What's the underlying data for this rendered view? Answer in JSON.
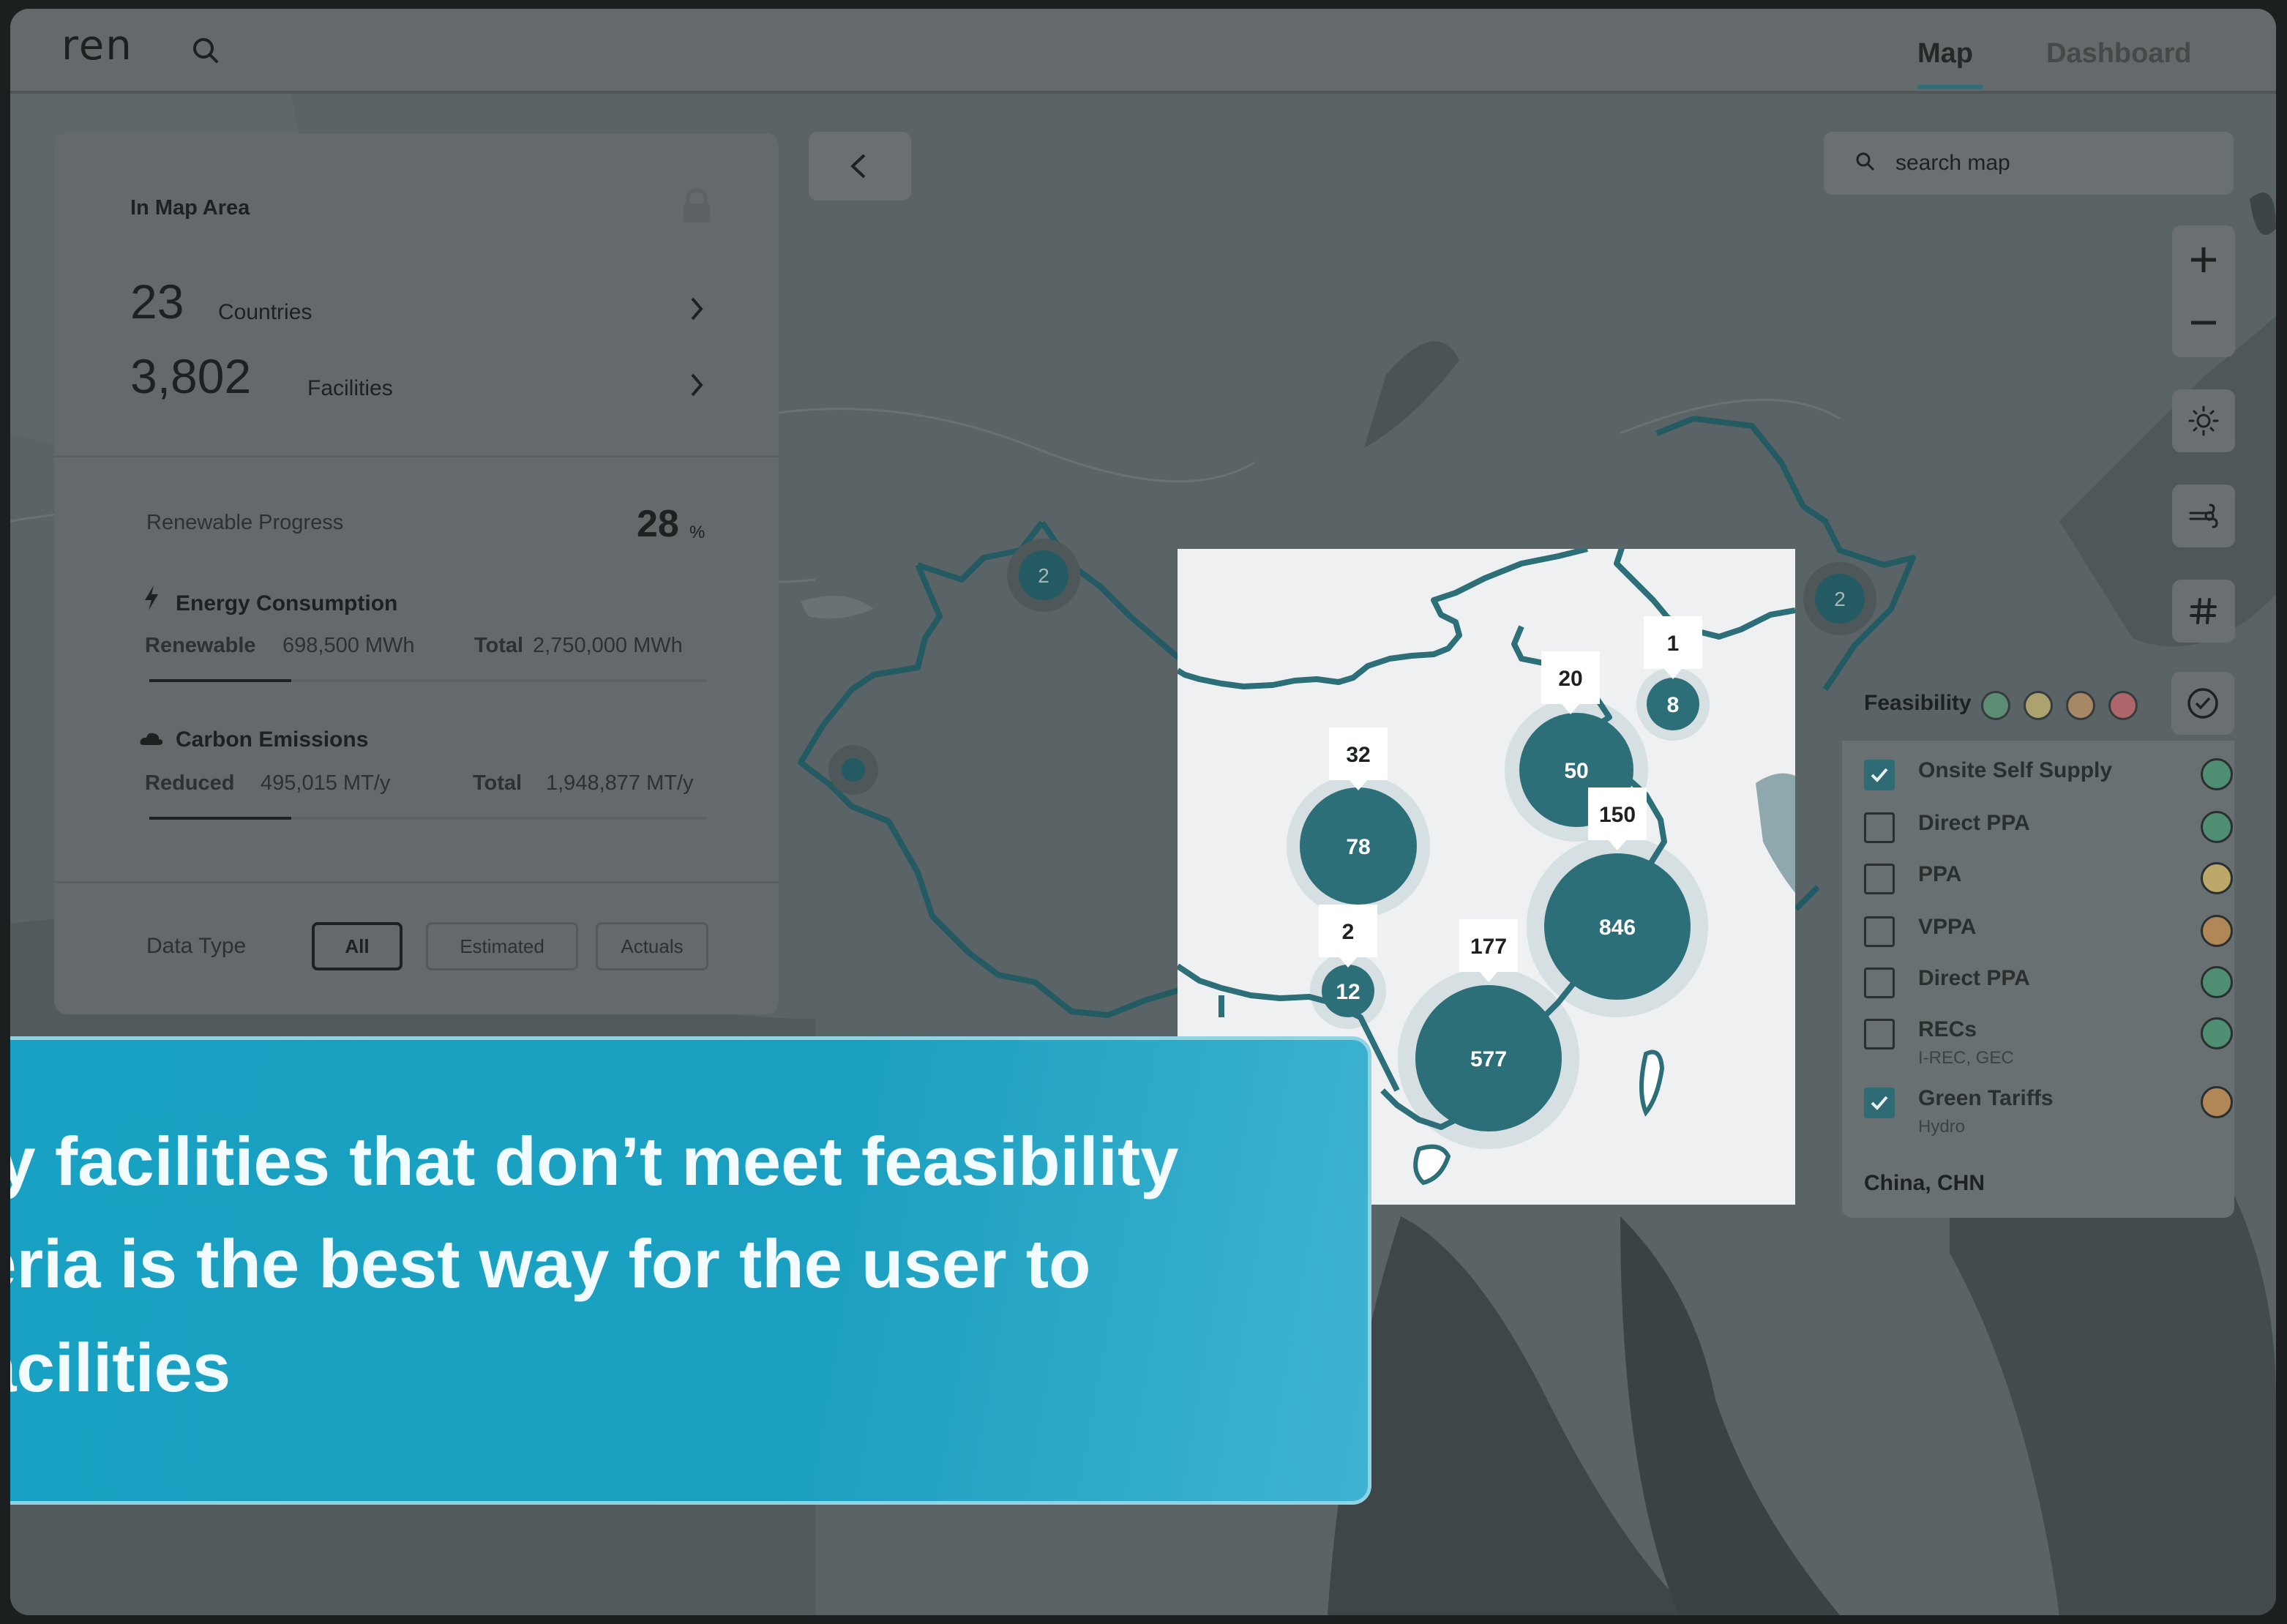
{
  "app": {
    "logo": "ren"
  },
  "nav": {
    "tabs": [
      {
        "label": "Map",
        "active": true
      },
      {
        "label": "Dashboard",
        "active": false
      }
    ]
  },
  "summary": {
    "title": "In Map Area",
    "countries_value": "23",
    "countries_label": "Countries",
    "facilities_value": "3,802",
    "facilities_label": "Facilities"
  },
  "progress": {
    "label": "Renewable Progress",
    "value": "28",
    "unit": "%",
    "energy": {
      "title": "Energy Consumption",
      "renewable_label": "Renewable",
      "renewable_value": "698,500 MWh",
      "total_label": "Total",
      "total_value": "2,750,000 MWh",
      "fraction": 0.254
    },
    "carbon": {
      "title": "Carbon Emissions",
      "reduced_label": "Reduced",
      "reduced_value": "495,015 MT/y",
      "total_label": "Total",
      "total_value": "1,948,877 MT/y",
      "fraction": 0.254
    }
  },
  "data_type": {
    "label": "Data Type",
    "options": [
      "All",
      "Estimated",
      "Actuals"
    ],
    "selected": "All"
  },
  "search": {
    "placeholder": "search map"
  },
  "feasibility": {
    "title": "Feasibility",
    "legend_colors": [
      "#5e9b78",
      "#c7b774",
      "#c09466",
      "#c9686b"
    ],
    "items": [
      {
        "name": "Onsite Self Supply",
        "sub": "",
        "checked": true,
        "color": "#4f8e73"
      },
      {
        "name": "Direct PPA",
        "sub": "",
        "checked": false,
        "color": "#4f8e73"
      },
      {
        "name": "PPA",
        "sub": "",
        "checked": false,
        "color": "#bba86a"
      },
      {
        "name": "VPPA",
        "sub": "",
        "checked": false,
        "color": "#b28758"
      },
      {
        "name": "Direct PPA",
        "sub": "",
        "checked": false,
        "color": "#4f8e73"
      },
      {
        "name": "RECs",
        "sub": "I-REC, GEC",
        "checked": false,
        "color": "#4f8e73"
      },
      {
        "name": "Green Tariffs",
        "sub": "Hydro",
        "checked": true,
        "color": "#b28758"
      }
    ],
    "country": "China, CHN"
  },
  "clusters": {
    "outside": [
      "2",
      "2"
    ],
    "inside": [
      "8",
      "50",
      "78",
      "846",
      "12",
      "577"
    ],
    "callouts": [
      "1",
      "20",
      "32",
      "150",
      "2",
      "177"
    ]
  },
  "caption": {
    "line1": "ny facilities that don’t meet feasibility",
    "line2": "teria is the best way for the user to",
    "line3": " facilities"
  },
  "colors": {
    "teal": "#2c6f79",
    "overlay": "#18a1c2"
  }
}
